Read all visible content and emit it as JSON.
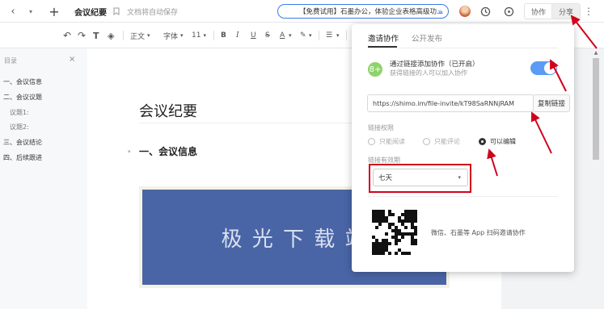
{
  "topbar": {
    "back_icon": "chevron-left",
    "dropdown_icon": "chevron-down",
    "add_icon": "plus",
    "doc_title": "会议纪要",
    "bookmark_icon": "bookmark",
    "save_status": "文档将自动保存",
    "banner": "【免费试用】石墨办公，体验企业表格高级功...",
    "banner_arrow": "»",
    "history_icon": "clock",
    "clock_icon": "clock",
    "collab_label": "协作",
    "share_label": "分享",
    "more_icon": "more-vertical"
  },
  "toolbar": {
    "style_label": "正文",
    "font_label": "字体",
    "size_label": "11",
    "list_label": "☰"
  },
  "sidebar": {
    "title": "目录",
    "close": "×",
    "items": [
      "一、会议信息",
      "二、会议议题",
      "议题1:",
      "议题2:",
      "三、会议结论",
      "四、后续跟进"
    ]
  },
  "doc": {
    "title": "会议纪要",
    "section_heading": "一、会议信息",
    "image_text": "极 光 下 载 站"
  },
  "share_popup": {
    "tabs": [
      "邀请协作",
      "公开发布"
    ],
    "invite_title": "通过链接添加协作（已开启）",
    "invite_sub": "获得链接的人可以加入协作",
    "link": "https://shimo.im/file-invite/kT98SaRNNjRAM",
    "copy_button": "复制链接",
    "permission_label": "链接权限",
    "permissions": [
      "只能阅读",
      "只能评论",
      "可以编辑"
    ],
    "permission_selected": 2,
    "expiry_label": "链接有效期",
    "expiry_value": "七天",
    "qr_caption": "微信、石墨等 App 扫码邀请协作",
    "toggle_on": true,
    "accent": "#5b9bf5",
    "highlight": "#d0021b"
  }
}
